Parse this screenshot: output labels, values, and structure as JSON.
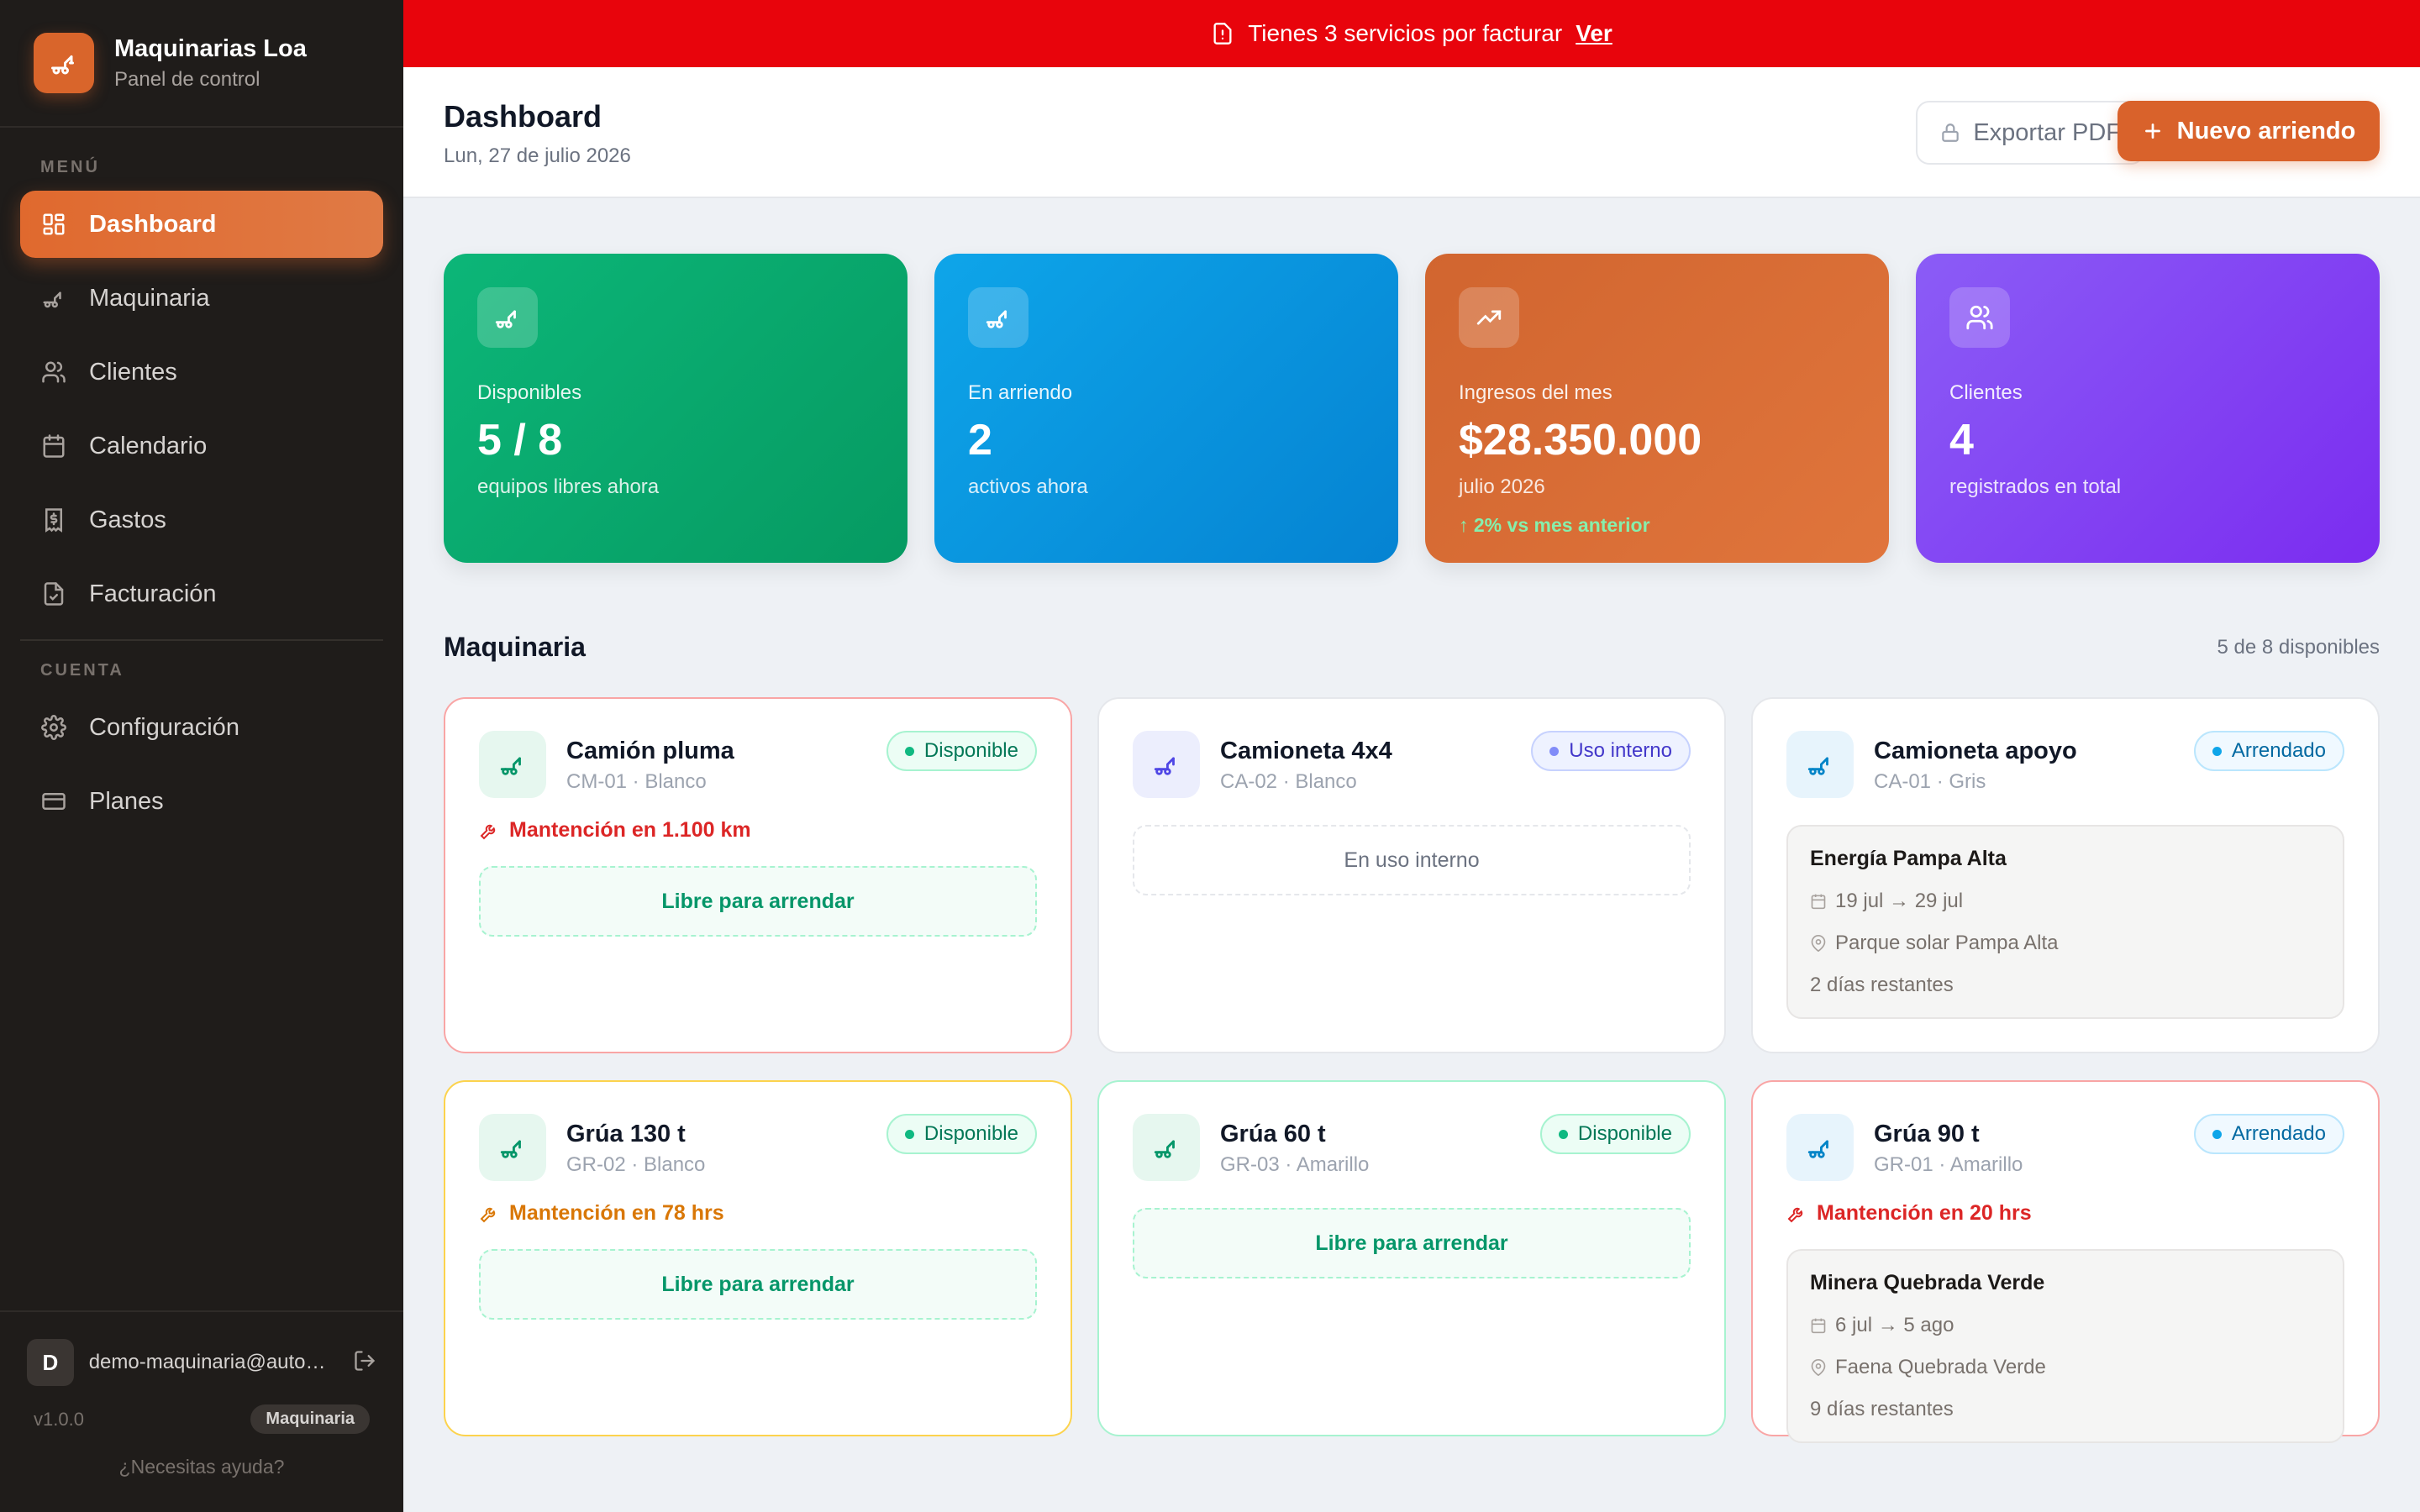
{
  "brand": {
    "name": "Maquinarias Loa",
    "subtitle": "Panel de control"
  },
  "sidebar": {
    "menu_label": "MENÚ",
    "items": [
      {
        "label": "Dashboard",
        "icon": "grid-icon",
        "active": true
      },
      {
        "label": "Maquinaria",
        "icon": "crane-icon"
      },
      {
        "label": "Clientes",
        "icon": "users-icon"
      },
      {
        "label": "Calendario",
        "icon": "calendar-icon"
      },
      {
        "label": "Gastos",
        "icon": "receipt-icon"
      },
      {
        "label": "Facturación",
        "icon": "file-check-icon"
      }
    ],
    "account_label": "CUENTA",
    "account_items": [
      {
        "label": "Configuración",
        "icon": "gear-icon"
      },
      {
        "label": "Planes",
        "icon": "card-icon"
      }
    ],
    "user": {
      "initial": "D",
      "email": "demo-maquinaria@automatiza.cl"
    },
    "version": "v1.0.0",
    "plan": "Maquinaria",
    "help": "¿Necesitas ayuda?"
  },
  "banner": {
    "text": "Tienes 3 servicios por facturar",
    "link": "Ver",
    "color": "#e8040c"
  },
  "header": {
    "title": "Dashboard",
    "date": "Lun, 27 de julio 2026",
    "export_label": "Exportar PDF",
    "new_label": "Nuevo arriendo",
    "accent": "#d9622b"
  },
  "stats": [
    {
      "label": "Disponibles",
      "value": "5 / 8",
      "sub": "equipos libres ahora",
      "icon": "crane-icon",
      "color": "#0cb678"
    },
    {
      "label": "En arriendo",
      "value": "2",
      "sub": "activos ahora",
      "icon": "crane-icon",
      "color": "#0ea5e9"
    },
    {
      "label": "Ingresos del mes",
      "value": "$28.350.000",
      "sub": "julio 2026",
      "trend": "↑ 2% vs mes anterior",
      "icon": "trending-up-icon",
      "color": "#d1652f"
    },
    {
      "label": "Clientes",
      "value": "4",
      "sub": "registrados en total",
      "icon": "users-icon",
      "color": "#8b5cf6"
    }
  ],
  "machinery": {
    "title": "Maquinaria",
    "count": "5 de 8 disponibles",
    "cards": [
      {
        "name": "Camión pluma",
        "code": "CM-01 · Blanco",
        "status": "Disponible",
        "maintenance": "Mantención en 1.100 km",
        "free": "Libre para arrendar"
      },
      {
        "name": "Camioneta 4x4",
        "code": "CA-02 · Blanco",
        "status": "Uso interno",
        "internal": "En uso interno"
      },
      {
        "name": "Camioneta apoyo",
        "code": "CA-01 · Gris",
        "status": "Arrendado",
        "client": "Energía Pampa Alta",
        "dates": "19 jul → 29 jul",
        "location": "Parque solar Pampa Alta",
        "remaining": "2 días restantes"
      },
      {
        "name": "Grúa 130 t",
        "code": "GR-02 · Blanco",
        "status": "Disponible",
        "maintenance": "Mantención en 78 hrs",
        "free": "Libre para arrendar"
      },
      {
        "name": "Grúa 60 t",
        "code": "GR-03 · Amarillo",
        "status": "Disponible",
        "free": "Libre para arrendar"
      },
      {
        "name": "Grúa 90 t",
        "code": "GR-01 · Amarillo",
        "status": "Arrendado",
        "maintenance": "Mantención en 20 hrs",
        "client": "Minera Quebrada Verde",
        "dates": "6 jul → 5 ago",
        "location": "Faena Quebrada Verde",
        "remaining": "9 días restantes"
      }
    ]
  }
}
